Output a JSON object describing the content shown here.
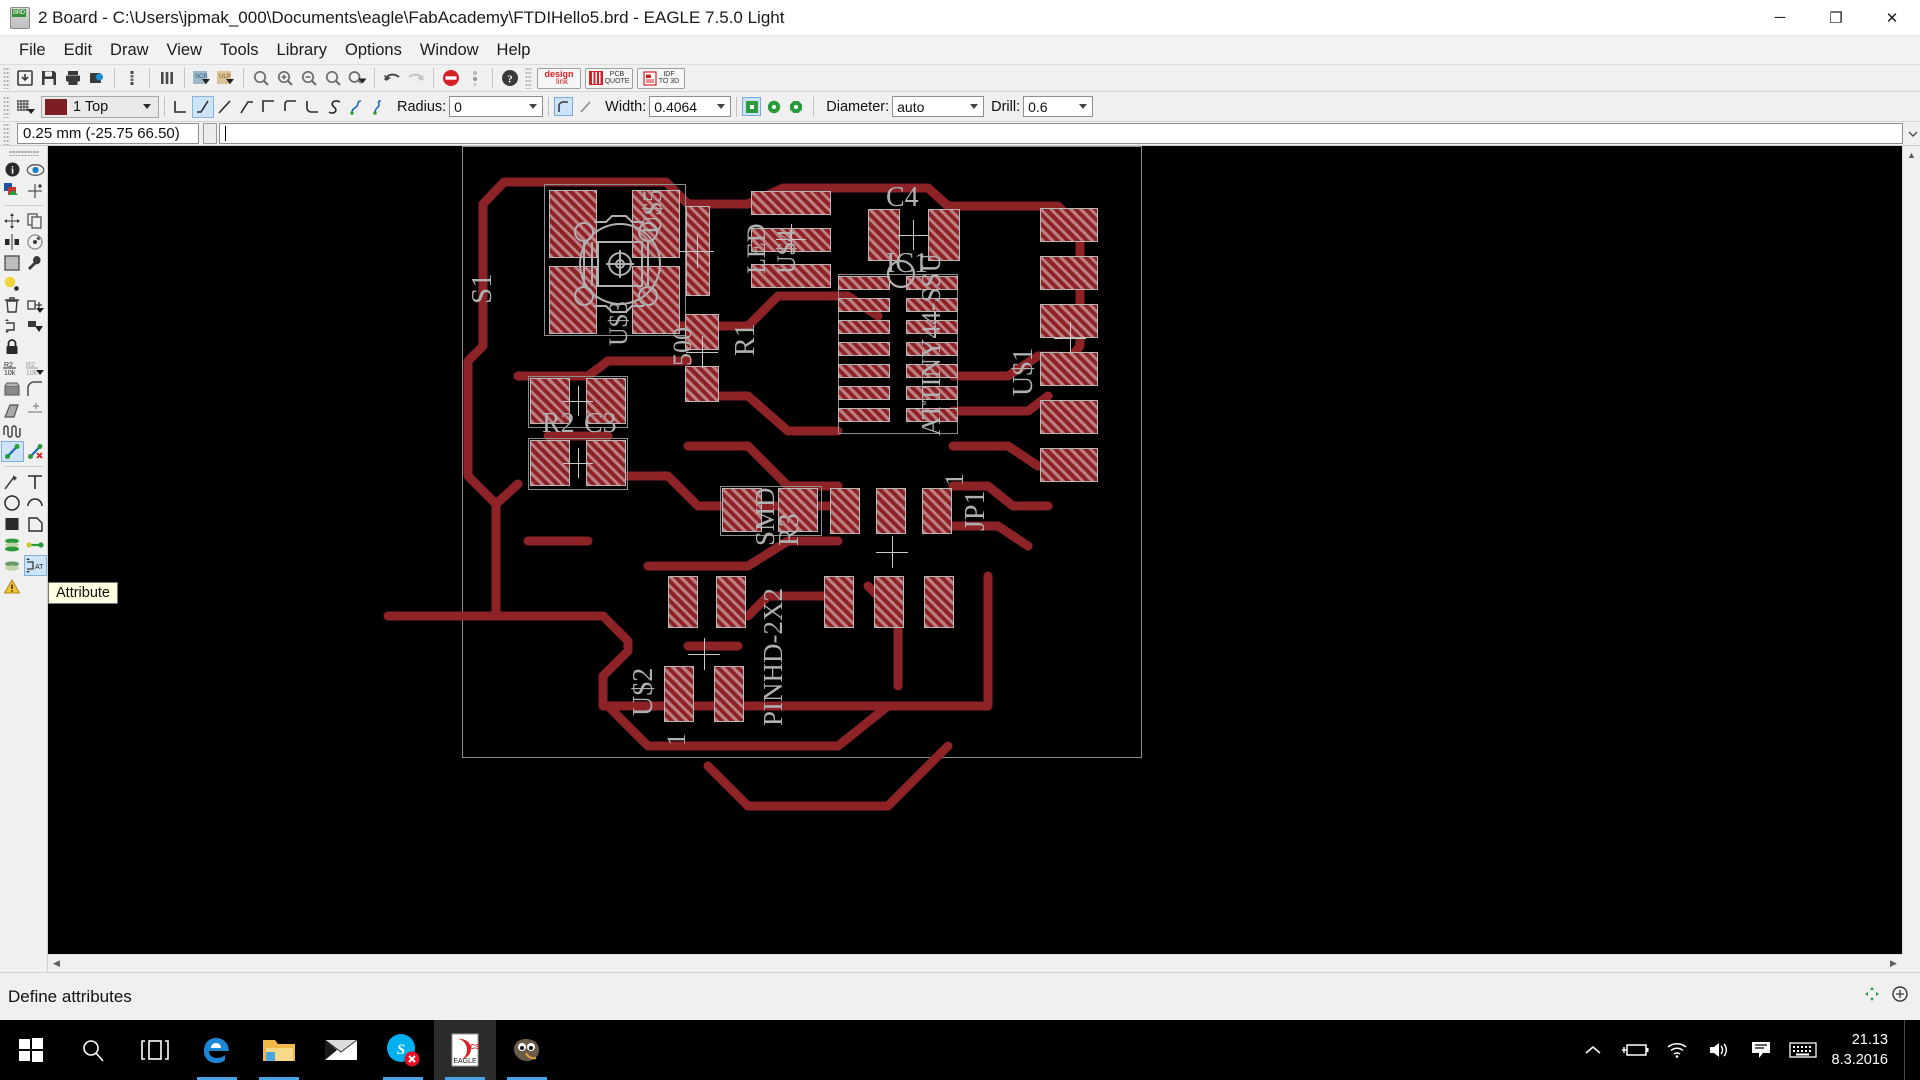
{
  "window": {
    "title": "2 Board - C:\\Users\\jpmak_000\\Documents\\eagle\\FabAcademy\\FTDIHello5.brd - EAGLE 7.5.0 Light",
    "app_icon": "brd-file-icon",
    "minimize": "─",
    "maximize": "❐",
    "close": "✕"
  },
  "menu": {
    "items": [
      "File",
      "Edit",
      "Draw",
      "View",
      "Tools",
      "Library",
      "Options",
      "Window",
      "Help"
    ]
  },
  "toolbar1": {
    "buttons": [
      {
        "name": "open-icon",
        "label": "Open"
      },
      {
        "name": "save-icon",
        "label": "Save"
      },
      {
        "name": "print-icon",
        "label": "Print"
      },
      {
        "name": "cam-processor-icon",
        "label": "CAM Processor"
      },
      {
        "name": "drc-icon",
        "label": "Design Rule Check"
      },
      {
        "name": "layer-settings-icon",
        "label": "Layer Settings"
      },
      {
        "name": "script-icon",
        "label": "Script"
      },
      {
        "name": "run-ulp-icon",
        "label": "Run ULP"
      },
      {
        "name": "zoom-fit-icon",
        "label": "Zoom to fit"
      },
      {
        "name": "zoom-in-icon",
        "label": "Zoom in"
      },
      {
        "name": "zoom-out-icon",
        "label": "Zoom out"
      },
      {
        "name": "zoom-select-icon",
        "label": "Zoom select"
      },
      {
        "name": "redraw-icon",
        "label": "Redraw"
      },
      {
        "name": "undo-icon",
        "label": "Undo"
      },
      {
        "name": "redo-icon",
        "label": "Redo"
      },
      {
        "name": "stop-icon",
        "label": "Stop"
      },
      {
        "name": "more-icon",
        "label": "More"
      },
      {
        "name": "help-icon",
        "label": "Help"
      }
    ],
    "design_link": {
      "line1": "design",
      "line2": "link"
    },
    "pcb_quote": {
      "line1": "PCB",
      "line2": "QUOTE"
    },
    "idf_to_3d": {
      "line1": "IDF",
      "line2": "TO 3D"
    }
  },
  "toolbar2": {
    "grid_icon": "grid-icon",
    "layer": {
      "value": "1 Top",
      "color": "#7d1f21"
    },
    "wire_bend_styles": [
      "bend-0",
      "bend-1",
      "bend-2",
      "bend-3",
      "bend-4",
      "bend-5",
      "bend-6",
      "bend-7",
      "bend-8",
      "bend-9"
    ],
    "selected_bend_index": 1,
    "radius_label": "Radius:",
    "radius_value": "0",
    "miter_buttons": [
      "round-miter-icon",
      "straight-miter-icon"
    ],
    "selected_miter_index": 0,
    "width_label": "Width:",
    "width_value": "0.4064",
    "via_shapes": [
      "via-square-icon",
      "via-round-icon",
      "via-octagon-icon"
    ],
    "selected_via_index": 0,
    "diameter_label": "Diameter:",
    "diameter_value": "auto",
    "drill_label": "Drill:",
    "drill_value": "0.6"
  },
  "coordbar": {
    "coordinate": "0.25 mm (-25.75 66.50)",
    "command_value": "",
    "command_placeholder": ""
  },
  "tool_palette": {
    "items": [
      {
        "name": "info-icon",
        "selected": false
      },
      {
        "name": "show-icon",
        "selected": false
      },
      {
        "name": "display-icon",
        "selected": false
      },
      {
        "name": "mark-icon",
        "selected": false
      },
      {
        "name": "move-icon",
        "selected": false
      },
      {
        "name": "copy-icon",
        "selected": false
      },
      {
        "name": "mirror-icon",
        "selected": false
      },
      {
        "name": "rotate-icon",
        "selected": false
      },
      {
        "name": "group-icon",
        "selected": false
      },
      {
        "name": "change-icon",
        "selected": false
      },
      {
        "name": "paste-icon",
        "selected": false
      },
      {
        "name": "delete-icon",
        "selected": false
      },
      {
        "name": "add-icon",
        "selected": false
      },
      {
        "name": "pinswap-icon",
        "selected": false
      },
      {
        "name": "replace-icon",
        "selected": false
      },
      {
        "name": "lock-icon",
        "selected": false
      },
      {
        "name": "name-icon",
        "selected": false
      },
      {
        "name": "value-icon",
        "selected": false
      },
      {
        "name": "smash-icon",
        "selected": false
      },
      {
        "name": "miter-icon",
        "selected": false
      },
      {
        "name": "split-icon",
        "selected": false
      },
      {
        "name": "optimize-icon",
        "selected": false
      },
      {
        "name": "meander-icon",
        "selected": false
      },
      {
        "name": "route-icon",
        "selected": true
      },
      {
        "name": "ripup-icon",
        "selected": false
      },
      {
        "name": "wire-icon",
        "selected": false
      },
      {
        "name": "text-icon",
        "selected": false
      },
      {
        "name": "circle-icon",
        "selected": false
      },
      {
        "name": "arc-icon",
        "selected": false
      },
      {
        "name": "rect-icon",
        "selected": false
      },
      {
        "name": "polygon-icon",
        "selected": false
      },
      {
        "name": "via-icon",
        "selected": false
      },
      {
        "name": "signal-icon",
        "selected": false
      },
      {
        "name": "hole-icon",
        "selected": false
      },
      {
        "name": "attribute-icon",
        "selected": true
      },
      {
        "name": "warning-icon",
        "selected": false
      }
    ]
  },
  "tooltip": {
    "text": "Attribute"
  },
  "statusbar": {
    "text": "Define attributes"
  },
  "taskbar": {
    "start": "windows-logo-icon",
    "search": "search-icon",
    "task_view": "task-view-icon",
    "apps": [
      {
        "name": "edge-icon",
        "label": "Microsoft Edge",
        "open": true,
        "active": false
      },
      {
        "name": "file-explorer-icon",
        "label": "File Explorer",
        "open": true,
        "active": false
      },
      {
        "name": "mail-icon",
        "label": "Mail",
        "open": false,
        "active": false
      },
      {
        "name": "skype-icon",
        "label": "Skype",
        "open": true,
        "active": false
      },
      {
        "name": "eagle-icon",
        "label": "EAGLE",
        "open": true,
        "active": true
      },
      {
        "name": "gimp-icon",
        "label": "GIMP",
        "open": true,
        "active": false
      }
    ],
    "tray": [
      {
        "name": "show-hidden-icons-chevron-icon"
      },
      {
        "name": "battery-charging-icon"
      },
      {
        "name": "wifi-icon"
      },
      {
        "name": "volume-icon"
      },
      {
        "name": "action-center-icon"
      },
      {
        "name": "touch-keyboard-icon"
      }
    ],
    "clock": {
      "time": "21.13",
      "date": "8.3.2016"
    }
  },
  "board": {
    "background": "#000000",
    "copper_color": "#8e2327",
    "silk_color": "#b0b0b0",
    "outline_color": "#8e8e8e",
    "component_labels": [
      "S1",
      "C4",
      "IC1",
      "R1",
      "R2",
      "C3",
      "R3",
      "JP1",
      "500",
      "U$1",
      "U$2",
      "U$3",
      "U$4",
      "U$5",
      "ATTINY44-SSU",
      "PINHD-2X2",
      "SMD",
      "LED",
      "1"
    ]
  }
}
